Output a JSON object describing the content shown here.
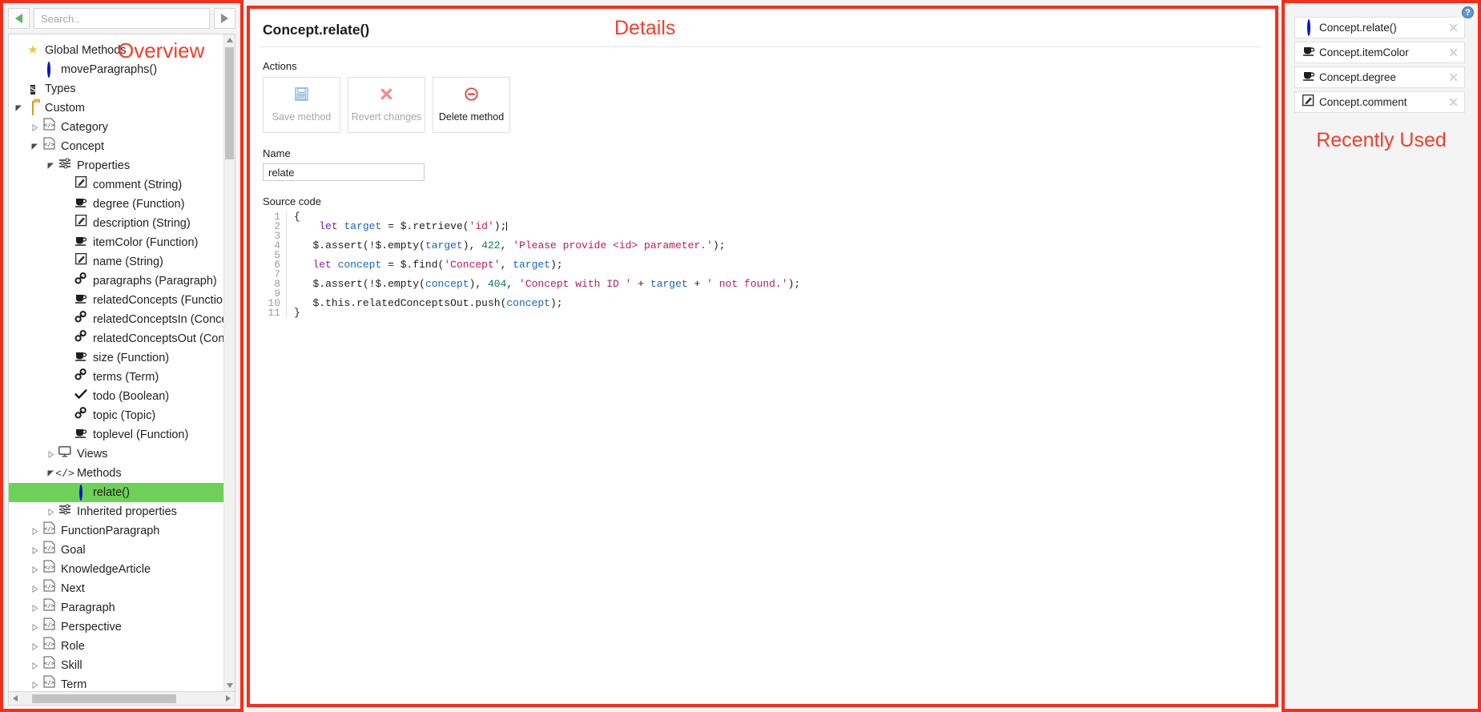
{
  "annotations": {
    "overview": "Overview",
    "details": "Details",
    "recently_used": "Recently Used"
  },
  "sidebar": {
    "search": {
      "value": "",
      "placeholder": "Search.."
    },
    "nav_back": "◀",
    "nav_forward": "▶",
    "tree": [
      {
        "label": "Global Methods",
        "indent": 0,
        "icon": "star-icon",
        "twisty": "none"
      },
      {
        "label": "moveParagraphs()",
        "indent": 1,
        "icon": "method-icon",
        "twisty": "none"
      },
      {
        "label": "Types",
        "indent": 0,
        "icon": "schema-icon",
        "twisty": "none"
      },
      {
        "label": "Custom",
        "indent": 0,
        "icon": "folder-icon",
        "twisty": "open"
      },
      {
        "label": "Category",
        "indent": 1,
        "icon": "type-icon",
        "twisty": "closed"
      },
      {
        "label": "Concept",
        "indent": 1,
        "icon": "type-icon",
        "twisty": "open"
      },
      {
        "label": "Properties",
        "indent": 2,
        "icon": "properties-icon",
        "twisty": "open"
      },
      {
        "label": "comment (String)",
        "indent": 3,
        "icon": "string-icon",
        "twisty": "none"
      },
      {
        "label": "degree (Function)",
        "indent": 3,
        "icon": "function-icon",
        "twisty": "none"
      },
      {
        "label": "description (String)",
        "indent": 3,
        "icon": "string-icon",
        "twisty": "none"
      },
      {
        "label": "itemColor (Function)",
        "indent": 3,
        "icon": "function-icon",
        "twisty": "none"
      },
      {
        "label": "name (String)",
        "indent": 3,
        "icon": "string-icon",
        "twisty": "none"
      },
      {
        "label": "paragraphs (Paragraph)",
        "indent": 3,
        "icon": "link-icon",
        "twisty": "none"
      },
      {
        "label": "relatedConcepts (Function)",
        "indent": 3,
        "icon": "function-icon",
        "twisty": "none"
      },
      {
        "label": "relatedConceptsIn (Concept)",
        "indent": 3,
        "icon": "link-icon",
        "twisty": "none"
      },
      {
        "label": "relatedConceptsOut (Concept)",
        "indent": 3,
        "icon": "link-icon",
        "twisty": "none"
      },
      {
        "label": "size (Function)",
        "indent": 3,
        "icon": "function-icon",
        "twisty": "none"
      },
      {
        "label": "terms (Term)",
        "indent": 3,
        "icon": "link-icon",
        "twisty": "none"
      },
      {
        "label": "todo (Boolean)",
        "indent": 3,
        "icon": "boolean-icon",
        "twisty": "none"
      },
      {
        "label": "topic (Topic)",
        "indent": 3,
        "icon": "link-icon",
        "twisty": "none"
      },
      {
        "label": "toplevel (Function)",
        "indent": 3,
        "icon": "function-icon",
        "twisty": "none"
      },
      {
        "label": "Views",
        "indent": 2,
        "icon": "view-icon",
        "twisty": "closed"
      },
      {
        "label": "Methods",
        "indent": 2,
        "icon": "methods-icon",
        "twisty": "open"
      },
      {
        "label": "relate()",
        "indent": 3,
        "icon": "method-icon",
        "twisty": "none",
        "selected": true
      },
      {
        "label": "Inherited properties",
        "indent": 2,
        "icon": "properties-icon",
        "twisty": "closed"
      },
      {
        "label": "FunctionParagraph",
        "indent": 1,
        "icon": "type-icon",
        "twisty": "closed"
      },
      {
        "label": "Goal",
        "indent": 1,
        "icon": "type-icon",
        "twisty": "closed"
      },
      {
        "label": "KnowledgeArticle",
        "indent": 1,
        "icon": "type-icon",
        "twisty": "closed"
      },
      {
        "label": "Next",
        "indent": 1,
        "icon": "type-icon",
        "twisty": "closed"
      },
      {
        "label": "Paragraph",
        "indent": 1,
        "icon": "type-icon",
        "twisty": "closed"
      },
      {
        "label": "Perspective",
        "indent": 1,
        "icon": "type-icon",
        "twisty": "closed"
      },
      {
        "label": "Role",
        "indent": 1,
        "icon": "type-icon",
        "twisty": "closed"
      },
      {
        "label": "Skill",
        "indent": 1,
        "icon": "type-icon",
        "twisty": "closed"
      },
      {
        "label": "Term",
        "indent": 1,
        "icon": "type-icon",
        "twisty": "closed"
      }
    ]
  },
  "details": {
    "title": "Concept.relate()",
    "actions_label": "Actions",
    "actions": [
      {
        "label": "Save method",
        "icon": "save-icon",
        "disabled": true
      },
      {
        "label": "Revert changes",
        "icon": "revert-icon",
        "disabled": true
      },
      {
        "label": "Delete method",
        "icon": "delete-icon",
        "disabled": false
      }
    ],
    "name_label": "Name",
    "name_value": "relate",
    "source_label": "Source code",
    "line_numbers": [
      "1",
      "2",
      "3",
      "4",
      "5",
      "6",
      "7",
      "8",
      "9",
      "10",
      "11"
    ],
    "source_code": [
      "{",
      "    let target = $.retrieve('id');",
      "",
      "   $.assert(!$.empty(target), 422, 'Please provide <id> parameter.');",
      "",
      "   let concept = $.find('Concept', target);",
      "",
      "   $.assert(!$.empty(concept), 404, 'Concept with ID ' + target + ' not found.');",
      "",
      "   $.this.relatedConceptsOut.push(concept);",
      "}"
    ]
  },
  "recent": {
    "help_label": "?",
    "items": [
      {
        "label": "Concept.relate()",
        "icon": "method-icon",
        "close": "✕"
      },
      {
        "label": "Concept.itemColor",
        "icon": "function-icon",
        "close": "✕"
      },
      {
        "label": "Concept.degree",
        "icon": "function-icon",
        "close": "✕"
      },
      {
        "label": "Concept.comment",
        "icon": "string-icon",
        "close": "✕"
      }
    ]
  },
  "colors": {
    "annotation_red": "#fb3b27",
    "border_red": "#fb2c1a",
    "selection_green": "#6ed157",
    "keyword_purple": "#7a1fa2",
    "variable_blue": "#1565c0",
    "string_crimson": "#c2185b",
    "number_green": "#0b7d4e"
  }
}
